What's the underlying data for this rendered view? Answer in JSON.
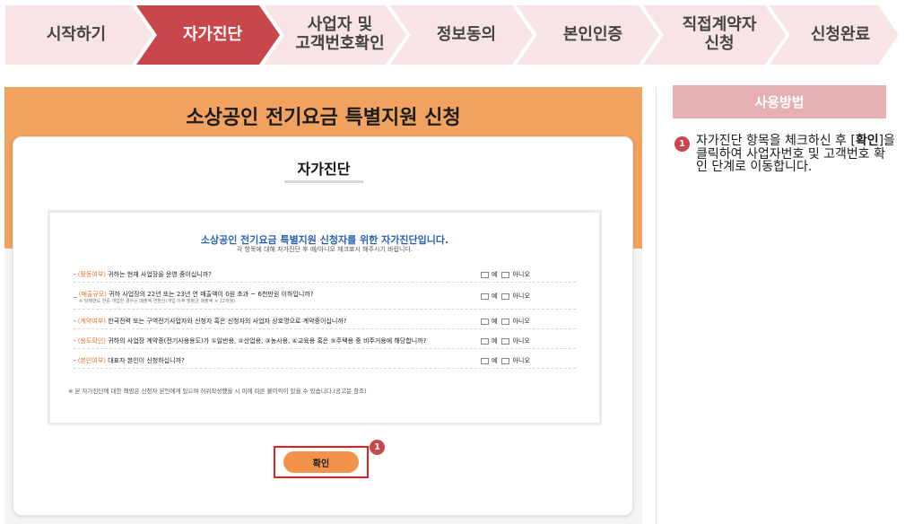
{
  "steps": [
    {
      "line1": "시작하기",
      "line2": "",
      "active": false
    },
    {
      "line1": "자가진단",
      "line2": "",
      "active": true
    },
    {
      "line1": "사업자 및",
      "line2": "고객번호확인",
      "active": false
    },
    {
      "line1": "정보동의",
      "line2": "",
      "active": false
    },
    {
      "line1": "본인인증",
      "line2": "",
      "active": false
    },
    {
      "line1": "직접계약자",
      "line2": "신청",
      "active": false
    },
    {
      "line1": "신청완료",
      "line2": "",
      "active": false
    }
  ],
  "colors": {
    "step_inactive": "#f8e4e4",
    "step_active": "#c9474b",
    "orange": "#f0a25e",
    "accent_blue": "#2b62b0",
    "tag_orange": "#e9722f",
    "usage_header": "#e6b0b3"
  },
  "main": {
    "title": "소상공인 전기요금 특별지원 신청",
    "card_title": "자가진단",
    "inner_title": "소상공인 전기요금 특별지원 신청자를 위한 자가진단입니다.",
    "inner_subtitle": "각 항목에 대해 자가진단 후 예/아니오 체크표시 해주시기 바랍니다.",
    "questions": [
      {
        "tag": "(활동여부)",
        "text": "귀하는 현재 사업장을 운영 중이십니까?",
        "note": ""
      },
      {
        "tag": "(매출규모)",
        "text": "귀하 사업장의 22년 또는 23년 연 매출액이 0원 초과 ~ 6천만원 이하입니까?",
        "note": "※ 당해연도 연중 개업한 경우는 매출액 연환산(개업 이후 월평균 매출액 × 12개월)"
      },
      {
        "tag": "(계약여부)",
        "text": "한국전력 또는 구역전기사업자와 신청자 혹은 신청자의 사업자 상호명으로 계약중이십니까?",
        "note": ""
      },
      {
        "tag": "(용도확인)",
        "text": "귀하의 사업장 계약종(전기사용용도)가 ①일반용, ②산업용, ③농사용, ④교육용 혹은 ⑤주택용 중 비주거용에 해당합니까?",
        "note": ""
      },
      {
        "tag": "(본인여부)",
        "text": "대표자 본인이 신청하십니까?",
        "note": ""
      }
    ],
    "option_yes": "예",
    "option_no": "아니오",
    "disclaimer": "※ 본 자가진단에 대한 책임은 신청자 본인에게 있으며 허위작성했을 시 이에 따른 불이익이 있을 수 있습니다.(공고문 참조)",
    "confirm_label": "확인",
    "badge_number": "1"
  },
  "usage": {
    "header": "사용방법",
    "badge_number": "1",
    "text_before": "자가진단 항목을 체크하신 후 [",
    "text_bold": "확인",
    "text_after": "]을 클릭하여 사업자번호 및 고객번호 확인 단계로 이동합니다."
  }
}
